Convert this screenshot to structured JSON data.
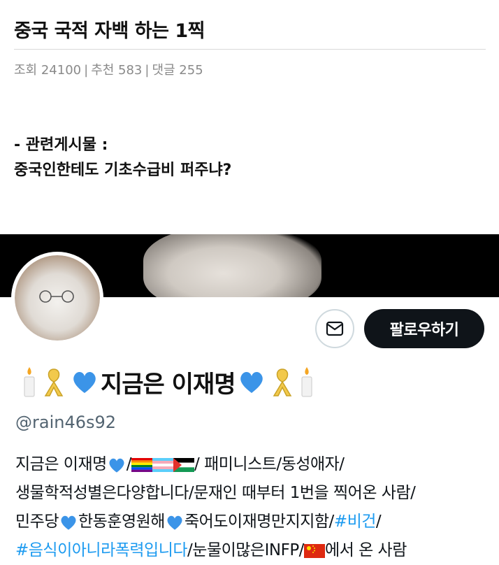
{
  "post": {
    "title": "중국 국적 자백 하는 1찍",
    "meta": {
      "views_label": "조회 24100",
      "recommend_label": "추천 583",
      "comments_label": "댓글 255",
      "separator": "|"
    },
    "related_heading": "- 관련게시물 :",
    "related_title": "중국인한테도 기초수급비 퍼주냐?"
  },
  "profile": {
    "follow_label": "팔로우하기",
    "display_name_text": "지금은 이재명",
    "handle": "@rain46s92",
    "bio": {
      "line1_text": "지금은 이재명",
      "line1_sep1": "/",
      "line1_sep2": "/ 패미니스트/동성애자/",
      "line2": "생물학적성별은다양합니다/문재인 때부터 1번을 찍어온 사람/",
      "line3_a": "민주당",
      "line3_b": "한동훈영원해",
      "line3_c": "죽어도이재명만지지함/",
      "line3_link": "#비건",
      "line3_end": "/",
      "line4_link": "#음식이아니라폭력입니다",
      "line4_a": "/눈물이많은INFP/",
      "line4_b": "에서 온 사람"
    }
  },
  "colors": {
    "link": "#1d9bf0",
    "heart": "#3b94e8",
    "follow_bg": "#0f1419",
    "handle": "#536471",
    "banner": "#000000"
  },
  "icons": [
    "candle-icon",
    "yellow-ribbon-icon",
    "blue-heart-icon",
    "mail-icon",
    "rainbow-flag-icon",
    "trans-flag-icon",
    "palestine-flag-icon",
    "china-flag-icon"
  ]
}
